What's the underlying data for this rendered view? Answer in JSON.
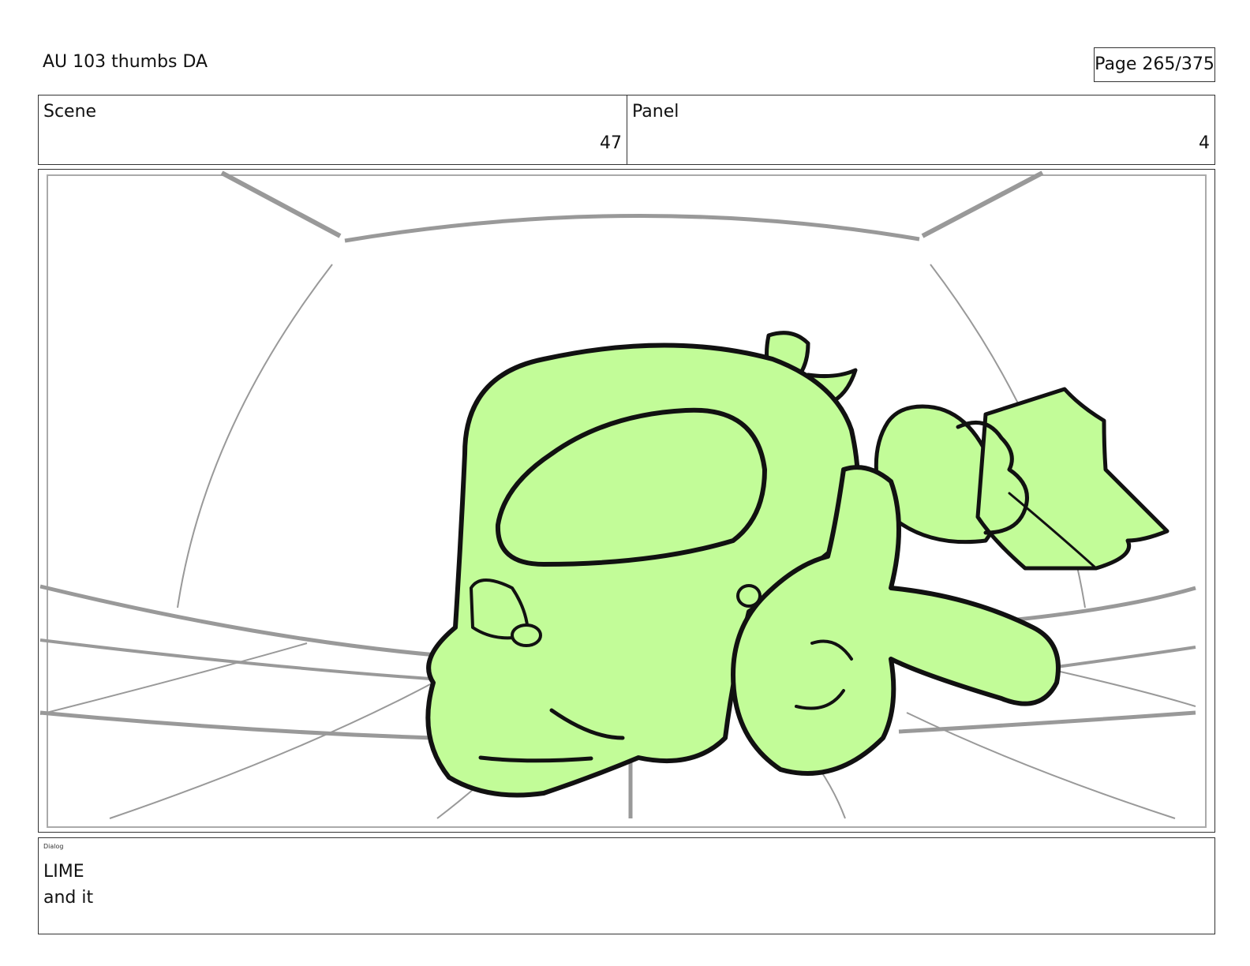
{
  "header": {
    "title": "AU 103 thumbs DA",
    "page": "Page 265/375"
  },
  "info": {
    "scene_label": "Scene",
    "scene_value": "47",
    "panel_label": "Panel",
    "panel_value": "4"
  },
  "drawing": {
    "fill_color": "#c2fc98",
    "line_color": "#111111",
    "background_line_color": "#999999"
  },
  "dialog": {
    "label": "Dialog",
    "lines": [
      "LIME",
      "and it"
    ]
  }
}
